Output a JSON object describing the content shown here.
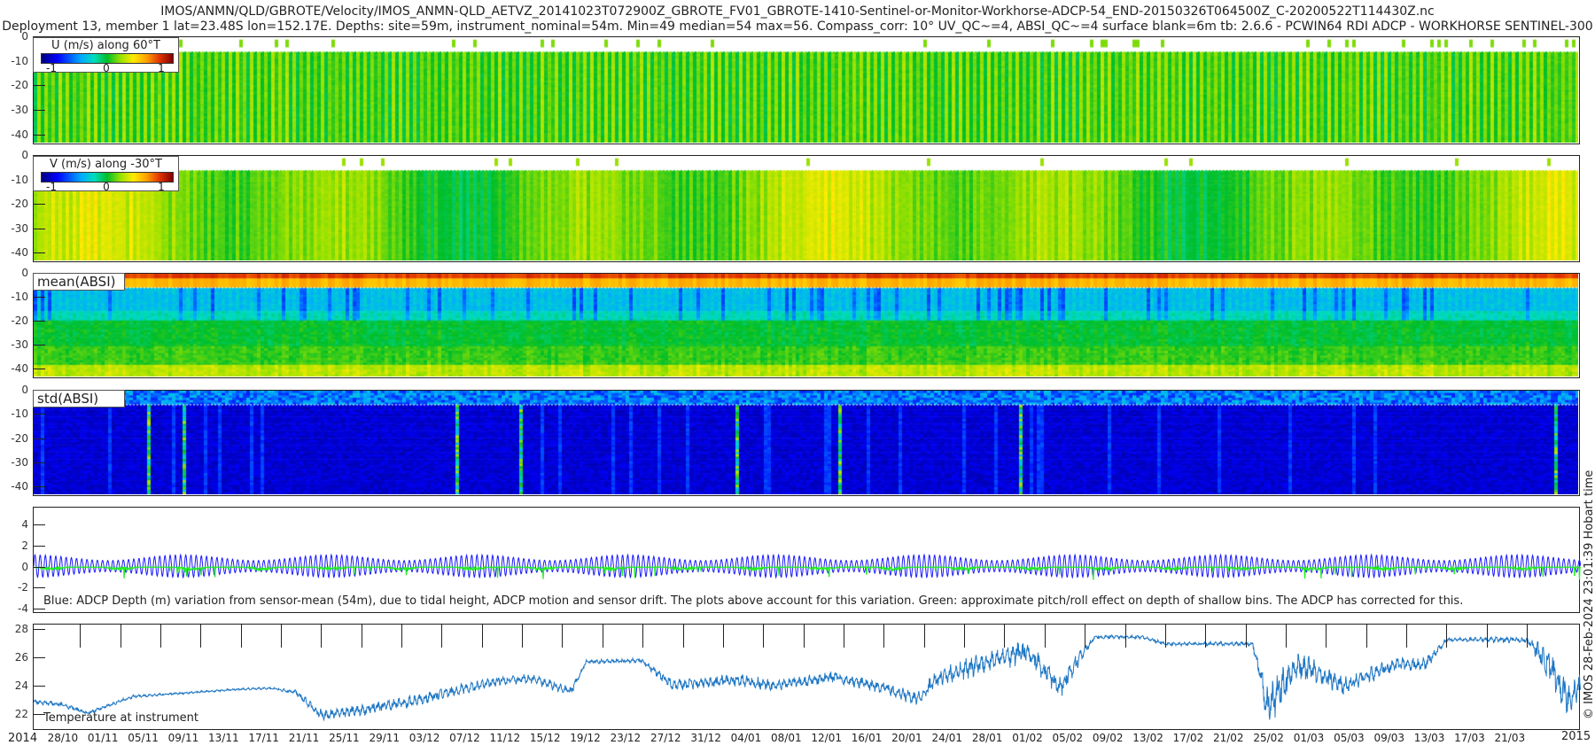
{
  "title_line1": "IMOS/ANMN/QLD/GBROTE/Velocity/IMOS_ANMN-QLD_AETVZ_20141023T072900Z_GBROTE_FV01_GBROTE-1410-Sentinel-or-Monitor-Workhorse-ADCP-54_END-20150326T064500Z_C-20200522T114430Z.nc",
  "title_line2": "Deployment 13, member 1 lat=23.48S lon=152.17E. Depths: site=59m, instrument_nominal=54m. Min=49 median=54 max=56. Compass_corr: 10° UV_QC~=4, ABSI_QC~=4 surface blank=6m tb: 2.6.6 - PCWIN64 RDI ADCP - WORKHORSE SENTINEL-300",
  "credit": "© IMOS 28-Feb-2024 23:01:39 Hobart time",
  "colors": {
    "depth_line": "#1a1aff",
    "pitch_roll_line": "#22ee22",
    "temperature_line": "#1f77c4",
    "axis": "#222222"
  },
  "chart_data": [
    {
      "type": "heatmap",
      "name": "U",
      "legend_title": "U (m/s) along 60°T",
      "clim": [
        -1.2,
        1.2
      ],
      "colorbar_ticks": [
        "-1",
        "0",
        "1"
      ],
      "ylabel_ticks": [
        "0",
        "-10",
        "-20",
        "-30",
        "-40"
      ],
      "ylim": [
        -44,
        0
      ],
      "surface_blank_m": 6,
      "typical_value": 0.05
    },
    {
      "type": "heatmap",
      "name": "V",
      "legend_title": "V (m/s) along -30°T",
      "clim": [
        -1.2,
        1.2
      ],
      "colorbar_ticks": [
        "-1",
        "0",
        "1"
      ],
      "ylabel_ticks": [
        "0",
        "-10",
        "-20",
        "-30",
        "-40"
      ],
      "ylim": [
        -44,
        0
      ],
      "surface_blank_m": 6,
      "typical_value": 0.15
    },
    {
      "type": "heatmap",
      "name": "meanABSI",
      "label": "mean(ABSI)",
      "ylabel_ticks": [
        "0",
        "-10",
        "-20",
        "-30",
        "-40"
      ],
      "ylim": [
        -44,
        0
      ]
    },
    {
      "type": "heatmap",
      "name": "stdABSI",
      "label": "std(ABSI)",
      "ylabel_ticks": [
        "0",
        "-10",
        "-20",
        "-30",
        "-40"
      ],
      "ylim": [
        -44,
        0
      ]
    },
    {
      "type": "line",
      "name": "depth",
      "caption": "Blue: ADCP Depth (m) variation from sensor-mean (54m), due to tidal height, ADCP motion and sensor drift. The plots above account for this variation. Green: approximate pitch/roll effect on depth of shallow bins. The ADCP has corrected for this.",
      "ylabel_ticks": [
        "4",
        "2",
        "0",
        "-2",
        "-4"
      ],
      "ylim": [
        -4.4,
        5.7
      ],
      "tidal_period_days": 0.5175,
      "spring_neap_days": 14.77,
      "tidal_amplitude_m": [
        0.55,
        1.1
      ],
      "series": [
        {
          "name": "ADCP depth variation"
        },
        {
          "name": "pitch/roll effect"
        }
      ]
    },
    {
      "type": "line",
      "name": "temperature",
      "caption": "Temperature at instrument",
      "ylabel_ticks": [
        "28",
        "26",
        "24",
        "22"
      ],
      "ylim": [
        20.9,
        28.4
      ],
      "knots_day_temp_var": [
        [
          0,
          22.8,
          0.2
        ],
        [
          2.8,
          22.6,
          0.2
        ],
        [
          5.4,
          22.0,
          0.15
        ],
        [
          9.9,
          23.2,
          0.15
        ],
        [
          14,
          23.4,
          0.1
        ],
        [
          20,
          23.7,
          0.1
        ],
        [
          23.6,
          23.8,
          0.1
        ],
        [
          26.1,
          23.5,
          0.2
        ],
        [
          28.7,
          21.8,
          0.5
        ],
        [
          33.2,
          22.3,
          0.5
        ],
        [
          37.3,
          22.8,
          0.5
        ],
        [
          41.3,
          23.5,
          0.5
        ],
        [
          46.4,
          24.3,
          0.4
        ],
        [
          49.4,
          24.5,
          0.4
        ],
        [
          53.5,
          23.6,
          0.4
        ],
        [
          55,
          25.7,
          0.2
        ],
        [
          60.5,
          25.8,
          0.2
        ],
        [
          63.6,
          24.0,
          0.5
        ],
        [
          69.7,
          24.4,
          0.6
        ],
        [
          73.7,
          24.0,
          0.5
        ],
        [
          79.8,
          24.6,
          0.5
        ],
        [
          84.8,
          23.8,
          0.5
        ],
        [
          87.9,
          23.0,
          0.6
        ],
        [
          89.9,
          24.5,
          0.8
        ],
        [
          94,
          25.5,
          0.9
        ],
        [
          99,
          26.5,
          1.0
        ],
        [
          102.1,
          23.8,
          1.0
        ],
        [
          104.1,
          26.0,
          0.6
        ],
        [
          105.6,
          27.5,
          0.15
        ],
        [
          110.2,
          27.5,
          0.15
        ],
        [
          112.7,
          27.0,
          0.15
        ],
        [
          121.3,
          27.0,
          0.2
        ],
        [
          122.8,
          22.5,
          2.0
        ],
        [
          125.9,
          25.5,
          1.2
        ],
        [
          130.4,
          24.0,
          0.8
        ],
        [
          135.5,
          25.5,
          0.6
        ],
        [
          138.5,
          25.5,
          0.6
        ],
        [
          140.6,
          27.3,
          0.15
        ],
        [
          148.6,
          27.3,
          0.3
        ],
        [
          150.7,
          25.5,
          1.5
        ],
        [
          152.7,
          23.0,
          1.5
        ],
        [
          154,
          24.0,
          1.0
        ]
      ]
    }
  ],
  "x_axis": {
    "start": "2014-10-23T07:29",
    "end": "2015-03-26T06:45",
    "year_start_label": "2014",
    "year_end_label": "2015",
    "tick_labels": [
      "28/10",
      "01/11",
      "05/11",
      "09/11",
      "13/11",
      "17/11",
      "21/11",
      "25/11",
      "29/11",
      "03/12",
      "07/12",
      "11/12",
      "15/12",
      "19/12",
      "23/12",
      "27/12",
      "31/12",
      "04/01",
      "08/01",
      "12/01",
      "16/01",
      "20/01",
      "24/01",
      "28/01",
      "01/02",
      "05/02",
      "09/02",
      "13/02",
      "17/02",
      "21/02",
      "25/02",
      "01/03",
      "05/03",
      "09/03",
      "13/03",
      "17/03",
      "21/03"
    ]
  }
}
